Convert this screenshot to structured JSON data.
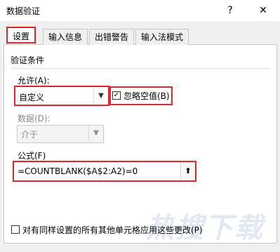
{
  "window": {
    "title": "数据验证",
    "help_label": "?",
    "close_label": "✕"
  },
  "tabs": [
    {
      "label": "设置",
      "active": true
    },
    {
      "label": "输入信息",
      "active": false
    },
    {
      "label": "出错警告",
      "active": false
    },
    {
      "label": "输入法模式",
      "active": false
    }
  ],
  "validation": {
    "group_title": "验证条件",
    "allow_label": "允许(A):",
    "allow_value": "自定义",
    "ignore_blank_label": "忽略空值(B)",
    "ignore_blank_checked": true,
    "data_label": "数据(D):",
    "data_value": "介于",
    "formula_label": "公式(F)",
    "formula_value": "=COUNTBLANK($A$2:A2)=0"
  },
  "apply_all_label": "对有同样设置的所有其他单元格应用这些更改(P)",
  "apply_all_checked": false,
  "watermark": "热搜下载",
  "icons": {
    "dropdown": "chevron-down-icon",
    "collapse": "collapse-dialog-icon",
    "check": "checkmark-icon"
  },
  "colors": {
    "highlight": "#e0262b"
  }
}
